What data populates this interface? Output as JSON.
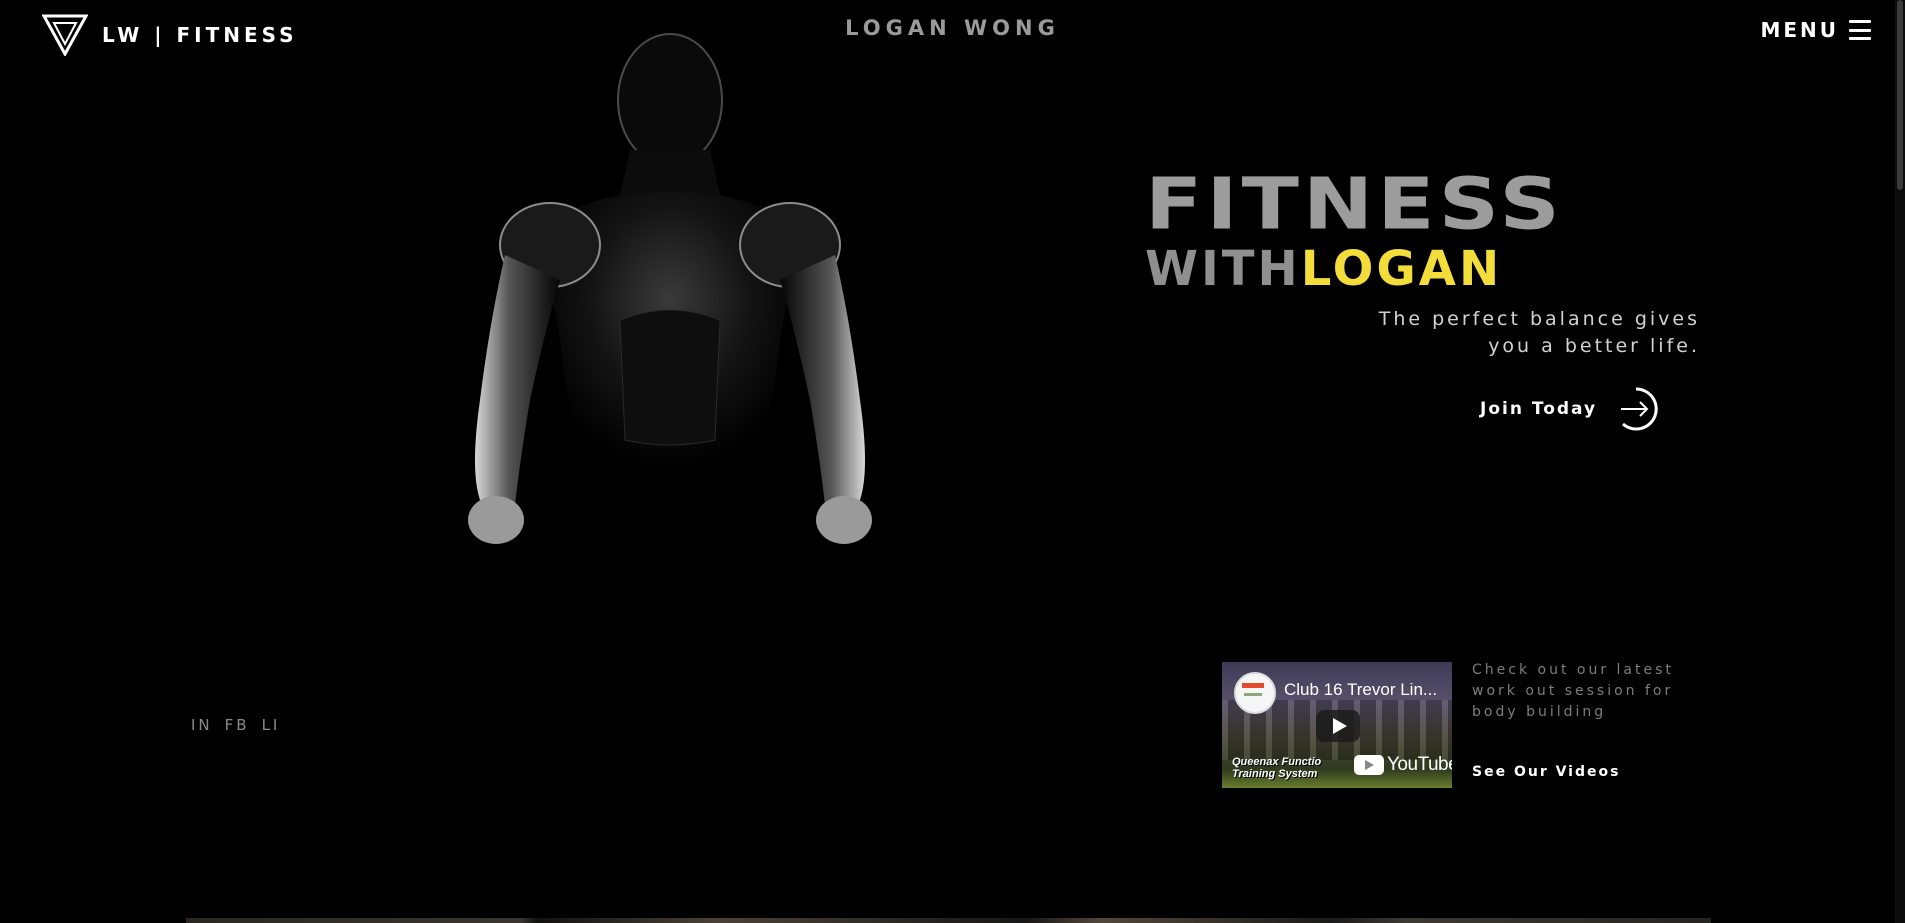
{
  "header": {
    "brand_text": "LW | FITNESS",
    "center_name": "LOGAN WONG",
    "menu_label": "MENU"
  },
  "hero": {
    "title_line1": "FITNESS",
    "title_line2_part1": "WITH",
    "title_line2_part2": "LOGAN",
    "tagline_line1": "The perfect balance gives",
    "tagline_line2": "you a better life.",
    "cta_label": "Join Today"
  },
  "socials": [
    "IN",
    "FB",
    "LI"
  ],
  "video": {
    "title": "Club 16 Trevor Lin...",
    "overlay_line1": "Queenax Functio",
    "overlay_line2": "Training System",
    "platform_label": "YouTube",
    "description": "Check out our latest work out session for body building",
    "link_label": "See Our Videos"
  },
  "colors": {
    "background": "#000000",
    "accent": "#f2dd3a",
    "headline_gray": "#9c9c9c"
  }
}
